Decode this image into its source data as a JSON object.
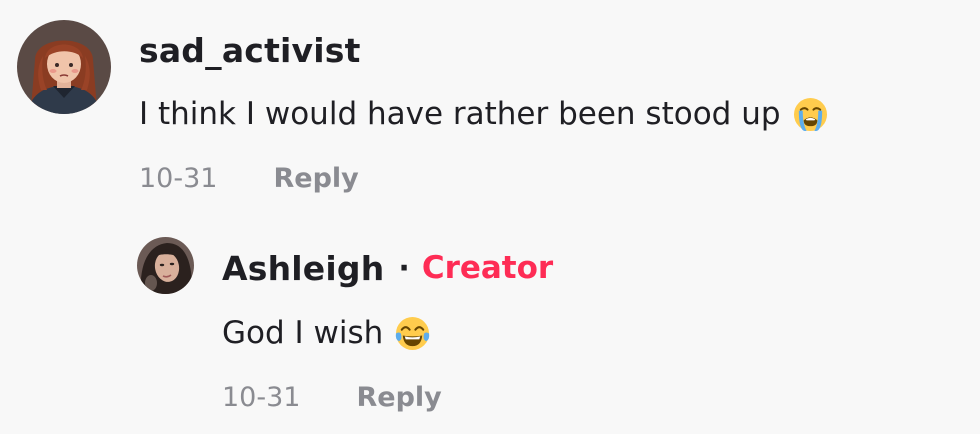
{
  "comments": [
    {
      "username": "sad_activist",
      "text": "I think I would have rather been stood up",
      "emoji": "loudly-crying-face-icon",
      "date": "10-31",
      "reply_label": "Reply"
    }
  ],
  "reply": {
    "username": "Ashleigh",
    "separator": "·",
    "badge": "Creator",
    "text": "God I wish",
    "emoji": "face-with-tears-of-joy-icon",
    "date": "10-31",
    "reply_label": "Reply"
  },
  "colors": {
    "background": "#f8f8f8",
    "username": "#1f1f24",
    "creator_badge": "#fe2c55",
    "meta": "#8a8b91"
  }
}
